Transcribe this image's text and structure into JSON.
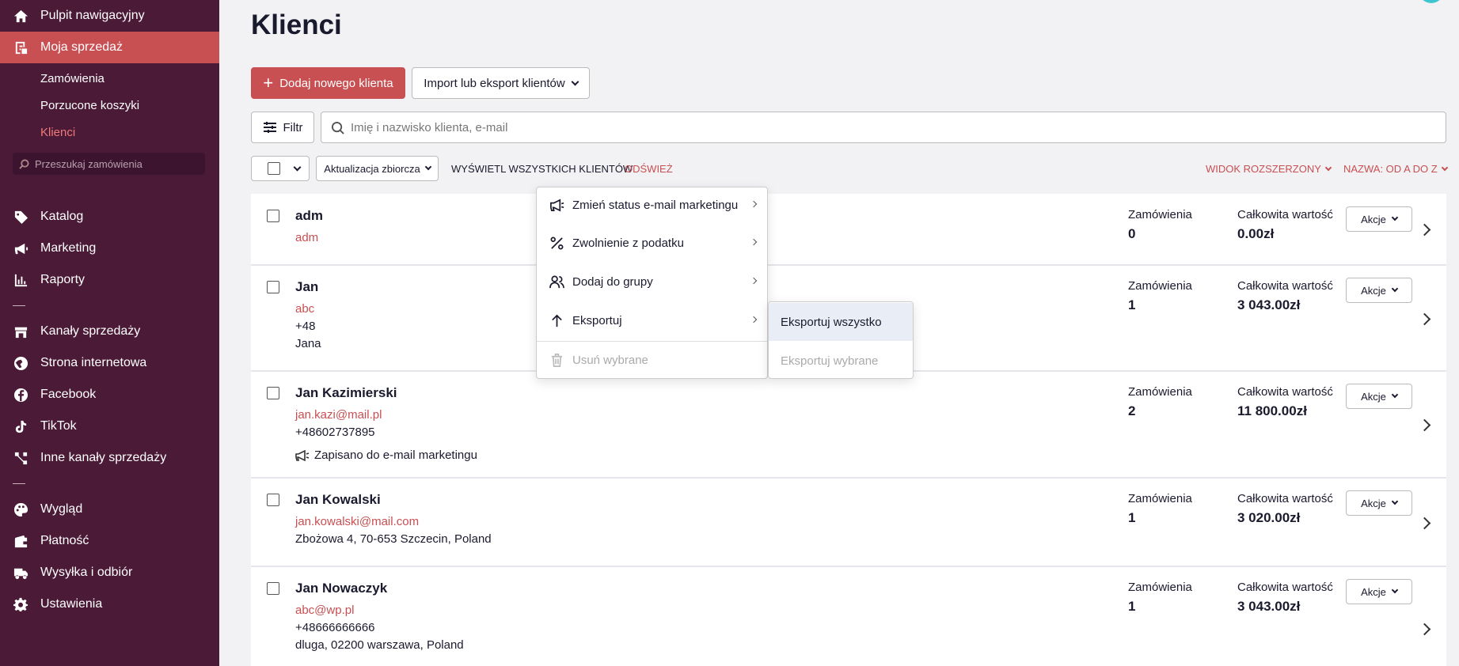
{
  "sidebar": {
    "dashboard": "Pulpit nawigacyjny",
    "my_sales": "Moja sprzedaż",
    "sub_items": [
      "Zamówienia",
      "Porzucone koszyki",
      "Klienci"
    ],
    "search_placeholder": "Przeszukaj zamówienia",
    "catalog": "Katalog",
    "marketing": "Marketing",
    "reports": "Raporty",
    "sales_channels": "Kanały sprzedaży",
    "website": "Strona internetowa",
    "facebook": "Facebook",
    "tiktok": "TikTok",
    "other_channels": "Inne kanały sprzedaży",
    "appearance": "Wygląd",
    "payment": "Płatność",
    "shipping": "Wysyłka i odbiór",
    "settings": "Ustawienia"
  },
  "page": {
    "title": "Klienci",
    "add_button": "Dodaj nowego klienta",
    "import_export_button": "Import lub eksport klientów",
    "filter_button": "Filtr",
    "search_placeholder": "Imię i nazwisko klienta, e-mail",
    "bulk_update_button": "Aktualizacja zbiorcza",
    "show_all": "WYŚWIETL WSZYSTKICH KLIENTÓW",
    "refresh": "ODŚWIEŻ",
    "view_toggle": "WIDOK ROZSZERZONY",
    "sort_toggle": "NAZWA: OD A DO Z"
  },
  "customers": [
    {
      "name": "adm",
      "email": "adm",
      "lines": [],
      "marketing": "",
      "orders_label": "Zamówienia",
      "orders": "0",
      "total_label": "Całkowita wartość",
      "total": "0.00zł",
      "actions": "Akcje"
    },
    {
      "name": "Jan",
      "email": "abc",
      "lines": [
        "+48",
        "Jana"
      ],
      "marketing": "",
      "orders_label": "Zamówienia",
      "orders": "1",
      "total_label": "Całkowita wartość",
      "total": "3 043.00zł",
      "actions": "Akcje"
    },
    {
      "name": "Jan Kazimierski",
      "email": "jan.kazi@mail.pl",
      "lines": [
        "+48602737895"
      ],
      "marketing": "Zapisano do e-mail marketingu",
      "orders_label": "Zamówienia",
      "orders": "2",
      "total_label": "Całkowita wartość",
      "total": "11 800.00zł",
      "actions": "Akcje"
    },
    {
      "name": "Jan Kowalski",
      "email": "jan.kowalski@mail.com",
      "lines": [
        "Zbożowa 4, 70-653 Szczecin, Poland"
      ],
      "marketing": "",
      "orders_label": "Zamówienia",
      "orders": "1",
      "total_label": "Całkowita wartość",
      "total": "3 020.00zł",
      "actions": "Akcje"
    },
    {
      "name": "Jan Nowaczyk",
      "email": "abc@wp.pl",
      "lines": [
        "+48666666666",
        "dluga, 02200 warszawa, Poland"
      ],
      "marketing": "",
      "orders_label": "Zamówienia",
      "orders": "1",
      "total_label": "Całkowita wartość",
      "total": "3 043.00zł",
      "actions": "Akcje"
    }
  ],
  "bulk_menu": {
    "items": [
      "Zmień status e-mail marketingu",
      "Zwolnienie z podatku",
      "Dodaj do grupy",
      "Eksportuj",
      "Usuń wybrane"
    ]
  },
  "export_submenu": {
    "items": [
      "Eksportuj wszystko",
      "Eksportuj wybrane"
    ]
  },
  "colors": {
    "sidebar_bg": "#4a1a36",
    "accent": "#c84f52",
    "page_bg": "#f2f2f4"
  }
}
